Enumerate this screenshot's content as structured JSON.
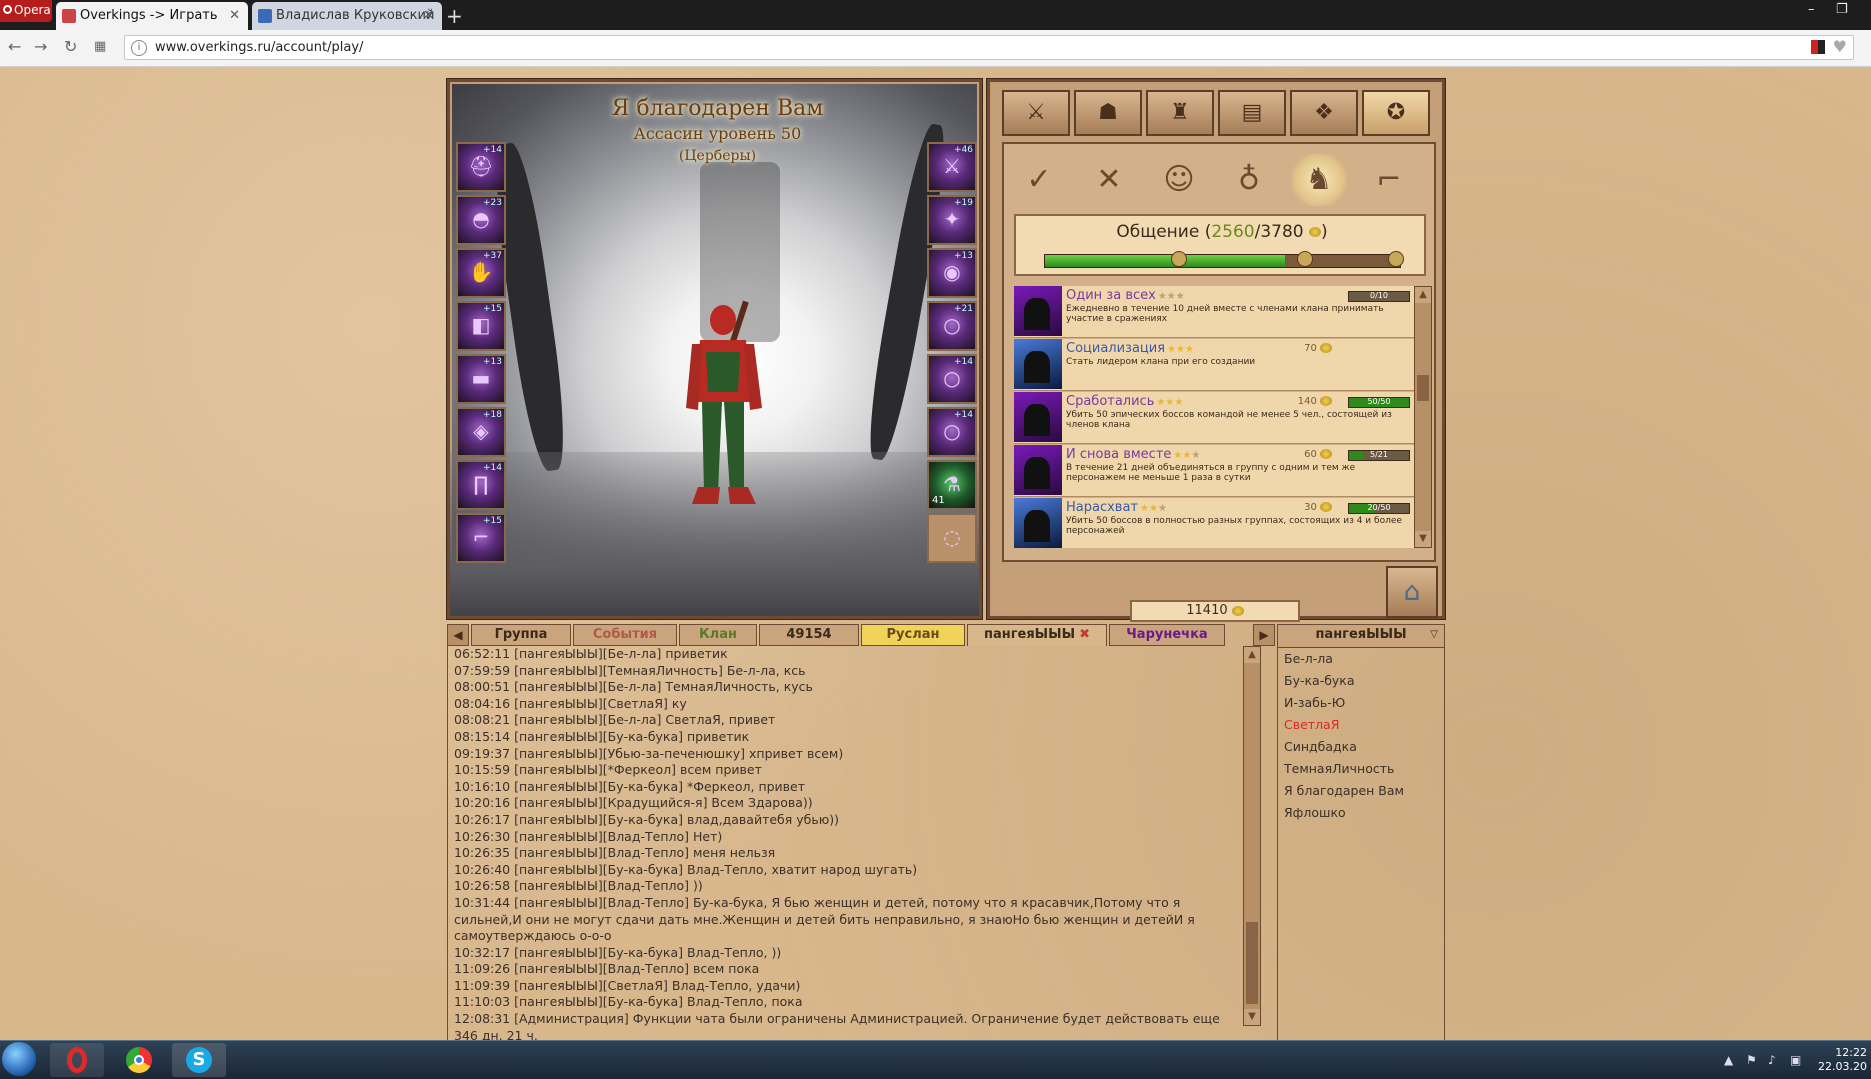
{
  "browser": {
    "menu_label": "Opera",
    "tabs": [
      {
        "label": "Overkings -> Играть",
        "active": true
      },
      {
        "label": "Владислав Круковский",
        "active": false
      }
    ],
    "new_tab": "+",
    "url": "www.overkings.ru/account/play/",
    "window_controls": [
      "–",
      "❐"
    ]
  },
  "character": {
    "name": "Я благодарен Вам",
    "class_level": "Ассасин уровень 50",
    "clan": "(Церберы)"
  },
  "equipment_left": [
    {
      "icon": "helmet-icon",
      "bonus": "+14"
    },
    {
      "icon": "shoulders-icon",
      "bonus": "+23"
    },
    {
      "icon": "gloves-icon",
      "bonus": "+37"
    },
    {
      "icon": "bracers-icon",
      "bonus": "+15"
    },
    {
      "icon": "belt-icon",
      "bonus": "+13"
    },
    {
      "icon": "chest-icon",
      "bonus": "+18"
    },
    {
      "icon": "legs-icon",
      "bonus": "+14"
    },
    {
      "icon": "boots-icon",
      "bonus": "+15"
    }
  ],
  "equipment_right": [
    {
      "icon": "weapon-icon",
      "bonus": "+46"
    },
    {
      "icon": "offhand-icon",
      "bonus": "+19"
    },
    {
      "icon": "amulet-icon",
      "bonus": "+13"
    },
    {
      "icon": "ring-icon",
      "bonus": "+21"
    },
    {
      "icon": "ring-icon",
      "bonus": "+14"
    },
    {
      "icon": "ring-icon",
      "bonus": "+14"
    },
    {
      "icon": "potion-icon",
      "count": "41"
    },
    {
      "icon": "empty-slot-icon"
    }
  ],
  "main_tabs": [
    "crossed-swords-icon",
    "group-icon",
    "backpack-icon",
    "spellbook-icon",
    "gift-icon",
    "achievements-icon"
  ],
  "sub_tabs": [
    "scroll-check-icon",
    "crossed-axes-icon",
    "masks-icon",
    "pouch-icon",
    "warriors-icon",
    "boots-icon"
  ],
  "reputation": {
    "label": "Общение (",
    "current": "2560",
    "max": "/3780",
    "close": ")",
    "fraction": 0.6772
  },
  "achievements": [
    {
      "name": "Один за всех",
      "stars": 0,
      "desc": "Ежедневно в течение 10 дней вместе с членами клана принимать участие в сражениях",
      "reward": "",
      "progress_text": "0/10",
      "progress": 0.0,
      "img": "purple"
    },
    {
      "name": "Социализация",
      "stars": 3,
      "desc": "Стать лидером клана при его создании",
      "reward": "70",
      "progress_text": "",
      "progress": null,
      "img": "blue"
    },
    {
      "name": "Сработались",
      "stars": 3,
      "desc": "Убить 50 эпических боссов командой не менее 5 чел., состоящей из членов клана",
      "reward": "140",
      "progress_text": "50/50",
      "progress": 1.0,
      "img": "purple"
    },
    {
      "name": "И снова вместе",
      "stars": 2,
      "desc": "В течение 21 дней объединяться в группу с одним и тем же персонажем не меньше 1 раза в сутки",
      "reward": "60",
      "progress_text": "5/21",
      "progress": 0.238,
      "img": "purple"
    },
    {
      "name": "Нарасхват",
      "stars": 2,
      "desc": "Убить 50 боссов в полностью разных группах, состоящих из 4 и более персонажей",
      "reward": "30",
      "progress_text": "20/50",
      "progress": 0.4,
      "img": "blue"
    }
  ],
  "gold": "11410",
  "chat_tabs": [
    {
      "label": "Группа",
      "style": ""
    },
    {
      "label": "События",
      "style": "red"
    },
    {
      "label": "Клан",
      "style": "green"
    },
    {
      "label": "49154",
      "style": ""
    },
    {
      "label": "Руслан",
      "style": "yellow"
    },
    {
      "label": "пангеяЫЫЫ",
      "style": "active",
      "closable": true
    },
    {
      "label": "Чарунечка",
      "style": "purple"
    }
  ],
  "chat_messages": [
    "06:52:11 [пангеяЫЫЫ][Бе-л-ла] приветик",
    "07:59:59 [пангеяЫЫЫ][ТемнаяЛичность] Бе-л-ла, ксь",
    "08:00:51 [пангеяЫЫЫ][Бе-л-ла] ТемнаяЛичность, кусь",
    "08:04:16 [пангеяЫЫЫ][СветлаЯ] ку",
    "08:08:21 [пангеяЫЫЫ][Бе-л-ла] СветлаЯ, привет",
    "08:15:14 [пангеяЫЫЫ][Бу-ка-бука] приветик",
    "09:19:37 [пангеяЫЫЫ][Убью-за-печенюшку] хпривет всем)",
    "10:15:59 [пангеяЫЫЫ][*Феркеол] всем привет",
    "10:16:10 [пангеяЫЫЫ][Бу-ка-бука] *Феркеол, привет",
    "10:20:16 [пангеяЫЫЫ][Крадущийся-я] Всем Здарова))",
    "10:26:17 [пангеяЫЫЫ][Бу-ка-бука] влад,давайтебя убью))",
    "10:26:30 [пангеяЫЫЫ][Влад-Тепло] Нет)",
    "10:26:35 [пангеяЫЫЫ][Влад-Тепло] меня нельзя",
    "10:26:40 [пангеяЫЫЫ][Бу-ка-бука] Влад-Тепло, хватит народ шугать)",
    "10:26:58 [пангеяЫЫЫ][Влад-Тепло] ))",
    "10:31:44 [пангеяЫЫЫ][Влад-Тепло] Бу-ка-бука, Я бью женщин и детей, потому что я красавчик,Потому что я сильней,И они не могут сдачи дать мне.Женщин и детей бить неправильно, я знаюНо бью женщин и детейИ я самоутверждаюсь о-о-о",
    "10:32:17 [пангеяЫЫЫ][Бу-ка-бука] Влад-Тепло, ))",
    "11:09:26 [пангеяЫЫЫ][Влад-Тепло] всем пока",
    "11:09:39 [пангеяЫЫЫ][СветлаЯ] Влад-Тепло, удачи)",
    "11:10:03 [пангеяЫЫЫ][Бу-ка-бука] Влад-Тепло, пока",
    "12:08:31 [Администрация] Функции чата были ограничены Администрацией. Ограничение будет действовать еще 346 дн. 21 ч."
  ],
  "user_list": {
    "channel": "пангеяЫЫЫ",
    "users": [
      {
        "name": "Бе-л-ла",
        "color": ""
      },
      {
        "name": "Бу-ка-бука",
        "color": ""
      },
      {
        "name": "И-забь-Ю",
        "color": ""
      },
      {
        "name": "СветлаЯ",
        "color": "red"
      },
      {
        "name": "Синдбадка",
        "color": ""
      },
      {
        "name": "ТемнаяЛичность",
        "color": ""
      },
      {
        "name": "Я благодарен Вам",
        "color": ""
      },
      {
        "name": "Яфлошко",
        "color": ""
      }
    ]
  },
  "taskbar": {
    "time": "12:22",
    "date": "22.03.20"
  }
}
